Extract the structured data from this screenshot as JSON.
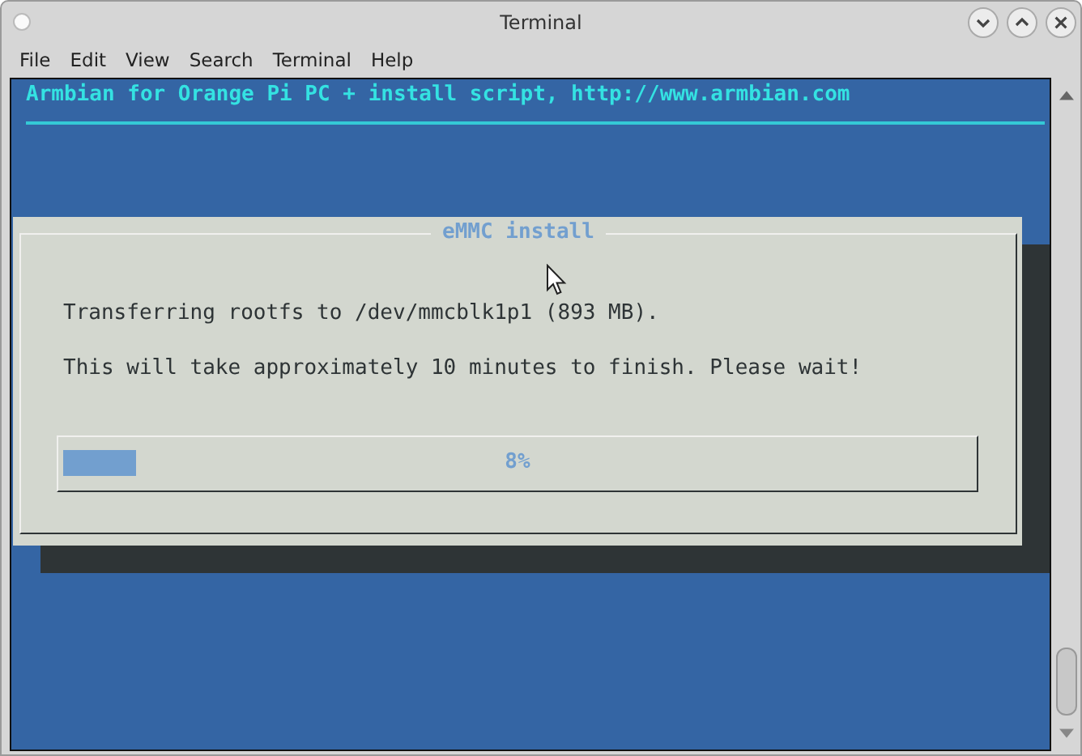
{
  "window": {
    "title": "Terminal"
  },
  "menu": [
    "File",
    "Edit",
    "View",
    "Search",
    "Terminal",
    "Help"
  ],
  "terminal": {
    "header": "Armbian for Orange Pi PC + install script, http://www.armbian.com",
    "dialog": {
      "title": "eMMC install",
      "lines": [
        "Transferring rootfs to /dev/mmcblk1p1 (893 MB).",
        "This will take approximately 10 minutes to finish. Please wait!"
      ],
      "gauge": {
        "level": 0.08,
        "reading": "8%"
      }
    }
  }
}
